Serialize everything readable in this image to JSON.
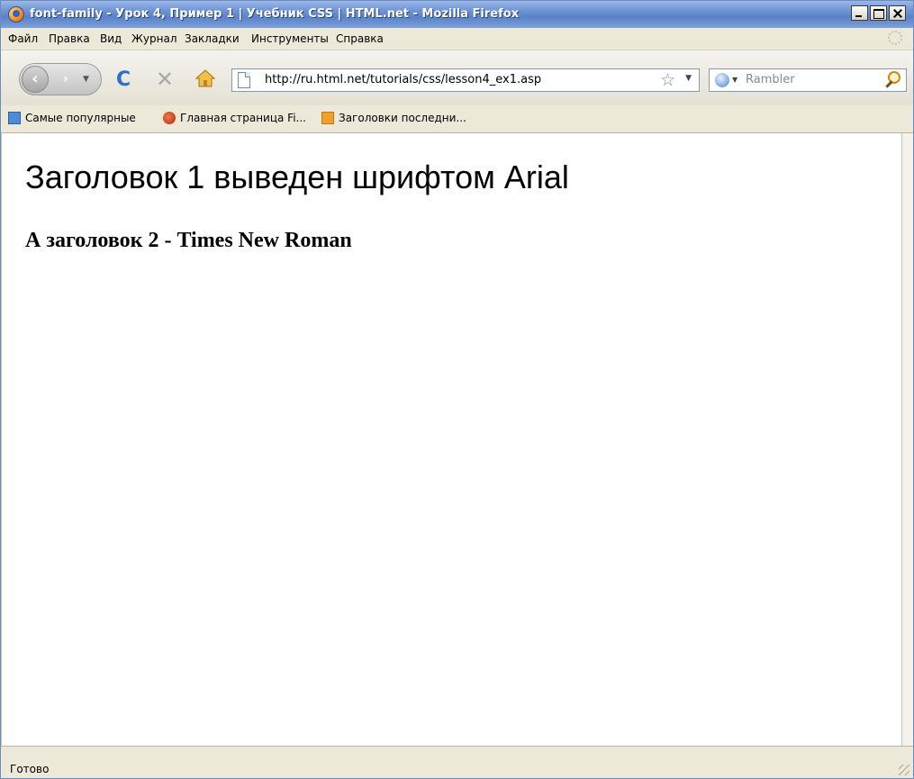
{
  "window": {
    "title": "font-family - Урок 4, Пример 1 | Учебник CSS | HTML.net - Mozilla Firefox"
  },
  "menu": {
    "items": [
      {
        "label": "Файл"
      },
      {
        "label": "Правка"
      },
      {
        "label": "Вид"
      },
      {
        "label": "Журнал"
      },
      {
        "label": "Закладки"
      },
      {
        "label": "Инструменты"
      },
      {
        "label": "Справка"
      }
    ]
  },
  "toolbar": {
    "url": "http://ru.html.net/tutorials/css/lesson4_ex1.asp",
    "search_placeholder": "Rambler",
    "icons": [
      "back-icon",
      "forward-icon",
      "reload-icon",
      "stop-icon",
      "home-icon",
      "bookmark-star-icon",
      "search-icon"
    ]
  },
  "bookmarks": {
    "items": [
      {
        "label": "Самые популярные",
        "icon": "blue-page-icon"
      },
      {
        "label": "Главная страница Fi...",
        "icon": "firefox-icon"
      },
      {
        "label": "Заголовки последни...",
        "icon": "rss-icon"
      }
    ]
  },
  "page": {
    "heading1": "Заголовок 1 выведен шрифтом Arial",
    "heading2": "А заголовок 2 - Times New Roman"
  },
  "status": {
    "text": "Готово"
  },
  "colors": {
    "titlebar": "#6f95d6",
    "chrome": "#ece9d8",
    "reload": "#2a6fd1"
  }
}
